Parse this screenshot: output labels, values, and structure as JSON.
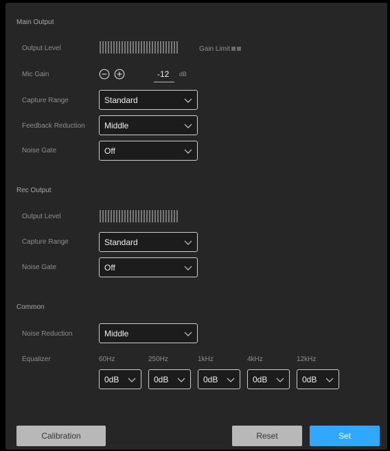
{
  "main_output": {
    "title": "Main Output",
    "output_level_label": "Output Level",
    "gain_limit_label": "Gain Limit",
    "mic_gain_label": "Mic Gain",
    "mic_gain_value": "-12",
    "mic_gain_unit": "dB",
    "capture_range_label": "Capture Range",
    "capture_range_value": "Standard",
    "feedback_reduction_label": "Feedback Reduction",
    "feedback_reduction_value": "Middle",
    "noise_gate_label": "Noise Gate",
    "noise_gate_value": "Off"
  },
  "rec_output": {
    "title": "Rec Output",
    "output_level_label": "Output Level",
    "capture_range_label": "Capture Range",
    "capture_range_value": "Standard",
    "noise_gate_label": "Noise Gate",
    "noise_gate_value": "Off"
  },
  "common": {
    "title": "Common",
    "noise_reduction_label": "Noise Reduction",
    "noise_reduction_value": "Middle",
    "equalizer_label": "Equalizer",
    "bands": [
      {
        "freq": "60Hz",
        "value": "0dB"
      },
      {
        "freq": "250Hz",
        "value": "0dB"
      },
      {
        "freq": "1kHz",
        "value": "0dB"
      },
      {
        "freq": "4kHz",
        "value": "0dB"
      },
      {
        "freq": "12kHz",
        "value": "0dB"
      }
    ]
  },
  "buttons": {
    "calibration": "Calibration",
    "reset": "Reset",
    "set": "Set"
  },
  "icons": {
    "minus": "minus-circle-icon",
    "plus": "plus-circle-icon",
    "dropdown": "chevron-down-icon"
  },
  "colors": {
    "background": "#262626",
    "accent": "#2fa9ff",
    "secondary_button": "#b8b8b8"
  }
}
